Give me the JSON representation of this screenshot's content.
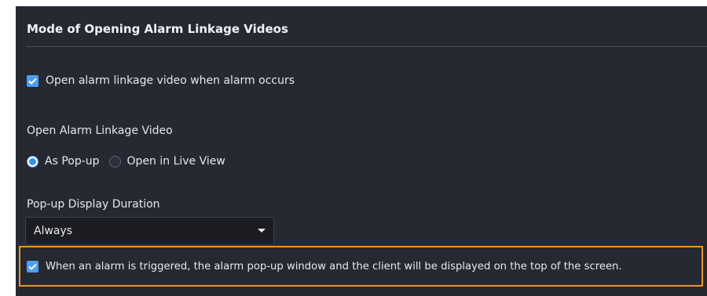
{
  "section": {
    "title": "Mode of Opening Alarm Linkage Videos"
  },
  "open_on_alarm": {
    "checked": true,
    "label": "Open alarm linkage video when alarm occurs"
  },
  "open_mode": {
    "label": "Open Alarm Linkage Video",
    "options": [
      {
        "label": "As Pop-up",
        "selected": true
      },
      {
        "label": "Open in Live View",
        "selected": false
      }
    ]
  },
  "popup_duration": {
    "label": "Pop-up Display Duration",
    "value": "Always"
  },
  "top_of_screen": {
    "checked": true,
    "label": "When an alarm is triggered, the alarm pop-up window and the client will be displayed on the top of the screen."
  },
  "colors": {
    "accent": "#4b9ef2",
    "highlight": "#e8962c",
    "panel_bg": "#262932"
  }
}
